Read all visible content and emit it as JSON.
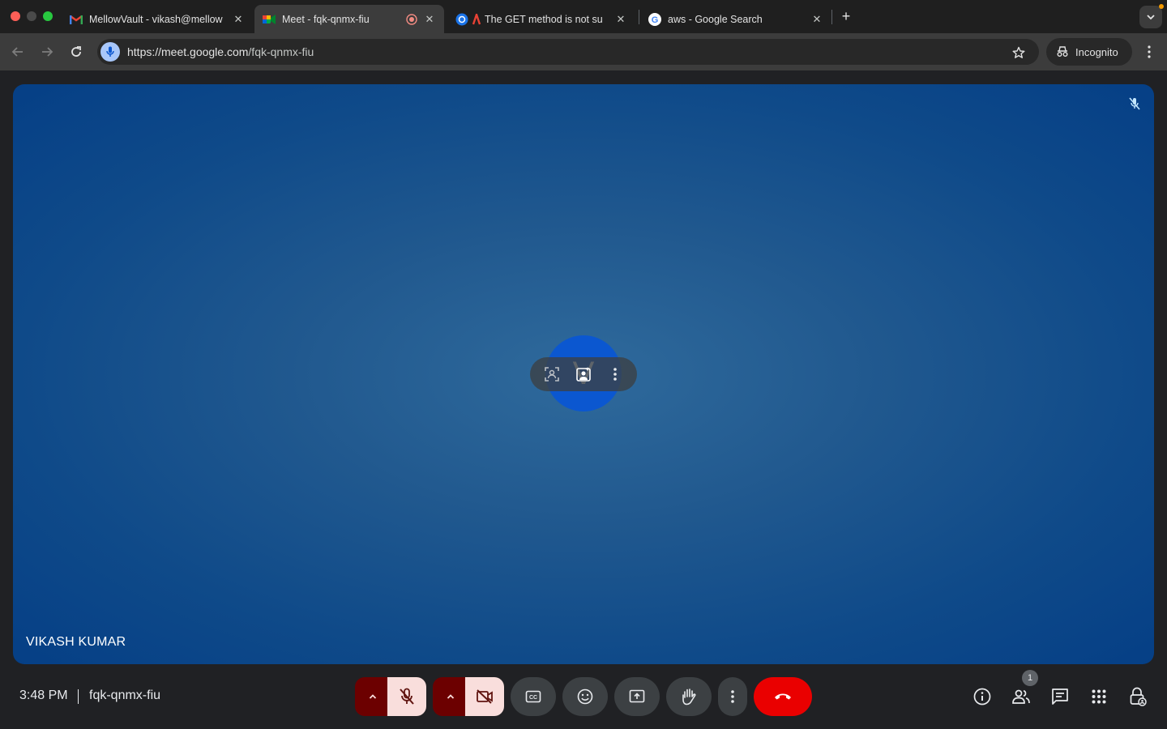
{
  "browser": {
    "tabs": [
      {
        "title": "MellowVault - vikash@mellow",
        "active": false
      },
      {
        "title": "Meet - fqk-qnmx-fiu",
        "active": true
      },
      {
        "title": "The GET method is not su",
        "active": false
      },
      {
        "title": "aws - Google Search",
        "active": false
      }
    ],
    "url_host": "https://meet.google.com",
    "url_path": "/fqk-qnmx-fiu",
    "incognito_label": "Incognito"
  },
  "meeting": {
    "participant_name": "VIKASH KUMAR",
    "avatar_initial": "V",
    "time": "3:48 PM",
    "code": "fqk-qnmx-fiu",
    "participant_count": "1"
  },
  "colors": {
    "hangup": "#ea0000",
    "muted_bg": "#f9dedc",
    "muted_arrow_bg": "#6c0000",
    "stage_blue": "#0f4a89"
  },
  "icons": {
    "mic": "mic-off-icon",
    "camera": "videocam-off-icon",
    "captions": "closed-captions-icon",
    "reactions": "emoji-icon",
    "present": "present-screen-icon",
    "hand": "raise-hand-icon",
    "more": "more-vert-icon",
    "leave": "call-end-icon",
    "info": "info-icon",
    "people": "people-icon",
    "chat": "chat-icon",
    "activities": "apps-grid-icon",
    "host": "host-controls-lock-icon"
  }
}
